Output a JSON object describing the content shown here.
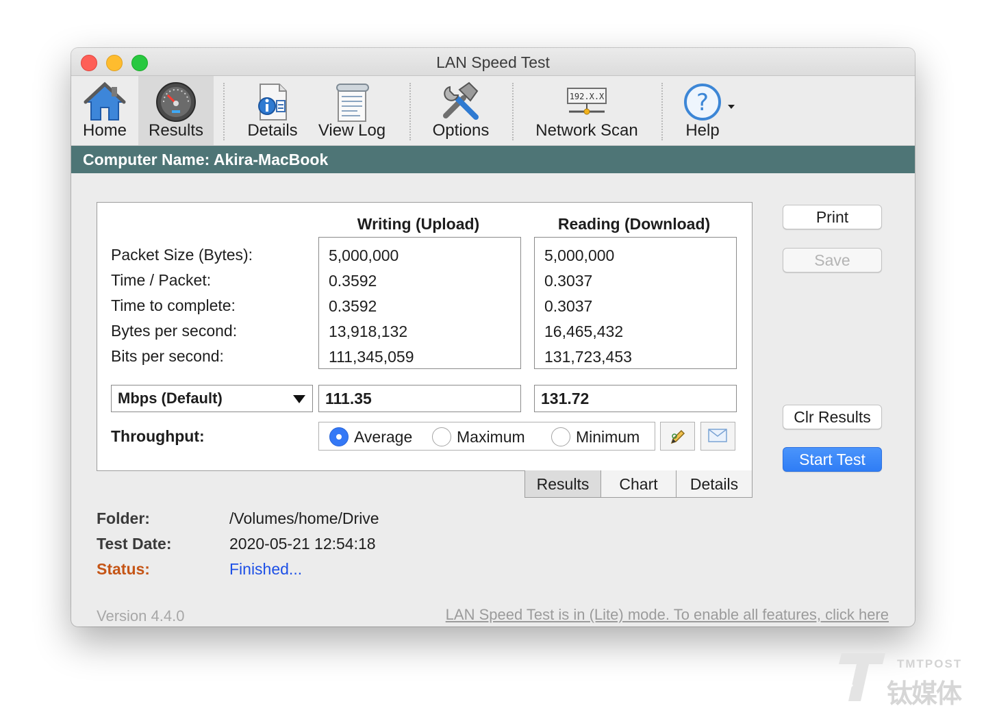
{
  "window": {
    "title": "LAN Speed Test"
  },
  "toolbar": {
    "items": [
      {
        "label": "Home",
        "icon": "home-icon"
      },
      {
        "label": "Results",
        "icon": "speedometer-icon",
        "selected": true
      },
      {
        "label": "Details",
        "icon": "details-icon"
      },
      {
        "label": "View Log",
        "icon": "log-icon"
      },
      {
        "label": "Options",
        "icon": "tools-icon"
      },
      {
        "label": "Network Scan",
        "icon": "network-scan-icon",
        "icon_text": "192.X.X"
      },
      {
        "label": "Help",
        "icon": "help-icon"
      }
    ]
  },
  "computer_name": "Computer Name: Akira-MacBook",
  "results": {
    "upload_header": "Writing (Upload)",
    "download_header": "Reading (Download)",
    "row_labels": [
      "Packet Size (Bytes):",
      "Time / Packet:",
      "Time to complete:",
      "Bytes per second:",
      "Bits per second:"
    ],
    "upload_values": [
      "5,000,000",
      "0.3592",
      "0.3592",
      "13,918,132",
      "111,345,059"
    ],
    "download_values": [
      "5,000,000",
      "0.3037",
      "0.3037",
      "16,465,432",
      "131,723,453"
    ],
    "unit_select": "Mbps (Default)",
    "upload_mbps": "111.35",
    "download_mbps": "131.72",
    "throughput_label": "Throughput:",
    "throughput_options": [
      "Average",
      "Maximum",
      "Minimum"
    ],
    "throughput_selected": "Average"
  },
  "tabs": [
    "Results",
    "Chart",
    "Details"
  ],
  "buttons": {
    "print": "Print",
    "save": "Save",
    "clear": "Clr Results",
    "start": "Start Test"
  },
  "info": {
    "folder_label": "Folder:",
    "folder_value": "/Volumes/home/Drive",
    "date_label": "Test Date:",
    "date_value": "2020-05-21 12:54:18",
    "status_label": "Status:",
    "status_value": "Finished..."
  },
  "footer": {
    "version": "Version 4.4.0",
    "lite_link": "LAN Speed Test is in (Lite) mode.  To enable all features, click here"
  },
  "watermark": {
    "latin": "TMTPOST",
    "cjk": "钛媒体"
  },
  "colors": {
    "name_bar": "#4e7576",
    "status_label": "#c55516",
    "status_value": "#1c4fe6",
    "primary_button": "#2f7df5"
  }
}
